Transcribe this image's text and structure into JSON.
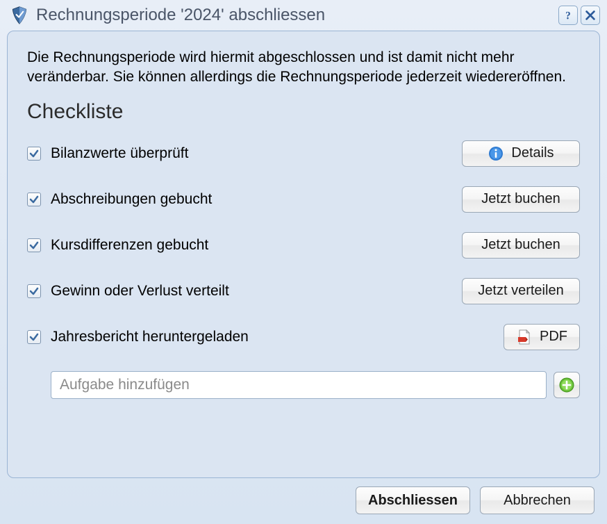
{
  "window": {
    "title": "Rechnungsperiode '2024' abschliessen"
  },
  "description": "Die Rechnungsperiode wird hiermit abgeschlossen und ist damit nicht mehr veränderbar. Sie können allerdings die Rechnungsperiode jederzeit wiedereröffnen.",
  "checklist": {
    "heading": "Checkliste",
    "items": [
      {
        "label": "Bilanzwerte überprüft",
        "action": "Details"
      },
      {
        "label": "Abschreibungen gebucht",
        "action": "Jetzt buchen"
      },
      {
        "label": "Kursdifferenzen gebucht",
        "action": "Jetzt buchen"
      },
      {
        "label": "Gewinn oder Verlust verteilt",
        "action": "Jetzt verteilen"
      },
      {
        "label": "Jahresbericht heruntergeladen",
        "action": "PDF"
      }
    ],
    "add_placeholder": "Aufgabe hinzufügen"
  },
  "footer": {
    "primary": "Abschliessen",
    "cancel": "Abbrechen"
  }
}
